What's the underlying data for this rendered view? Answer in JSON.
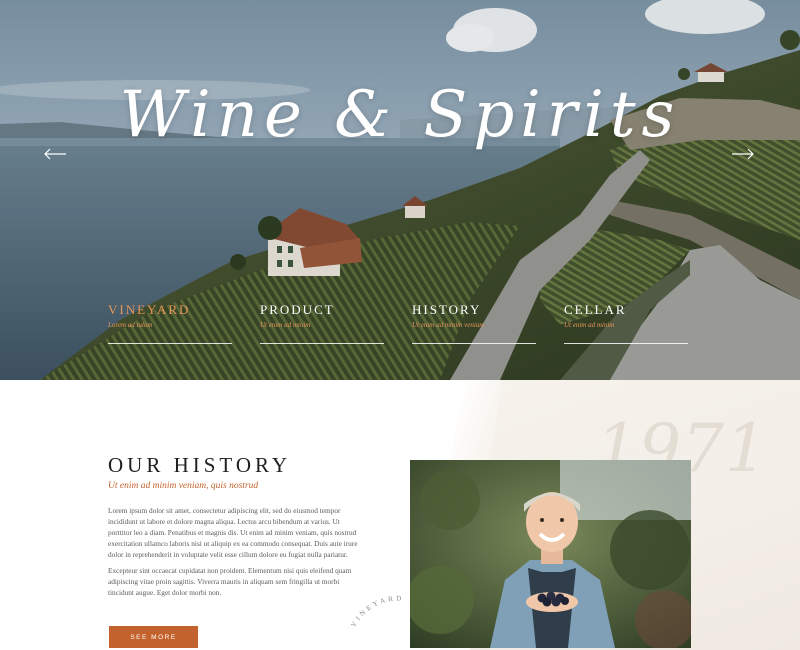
{
  "hero": {
    "title": "Wine & Spirits",
    "nav": [
      {
        "label": "Vineyard",
        "sub": "Lorem ad tulum",
        "active": true
      },
      {
        "label": "Product",
        "sub": "Ut enim ad minim",
        "active": false
      },
      {
        "label": "History",
        "sub": "Ut enim ad minim veniam",
        "active": false
      },
      {
        "label": "Cellar",
        "sub": "Ut enim ad minim",
        "active": false
      }
    ]
  },
  "history": {
    "year": "1971",
    "title": "Our History",
    "subtitle": "Ut enim ad minim veniam, quis nostrud",
    "paragraph1": "Lorem ipsum dolor sit amet, consectetur adipiscing elit, sed do eiusmod tempor incididunt ut labore et dolore magna aliqua. Lectus arcu bibendum at varius. Ut porttitor leo a diam. Penatibus et magnis dis. Ut enim ad minim veniam, quis nostrud exercitation ullamco laboris nisi ut aliquip ex ea commodo consequat. Duis aute irure dolor in reprehenderit in voluptate velit esse cillum dolore eu fugiat nulla pariatur.",
    "paragraph2": "Excepteur sint occaecat cupidatat non proident. Elementum nisi quis eleifend quam adipiscing vitae proin sagittis. Viverra mauris in aliquam sem fringilla ut morbi tincidunt augue. Eget dolor morbi non.",
    "button_label": "See more",
    "stamp_text": "VINEYARD"
  },
  "colors": {
    "accent": "#c4622d",
    "accent_light": "#e8965a",
    "paper": "#f4efe8"
  },
  "icons": {
    "prev": "arrow-left-icon",
    "next": "arrow-right-icon"
  }
}
